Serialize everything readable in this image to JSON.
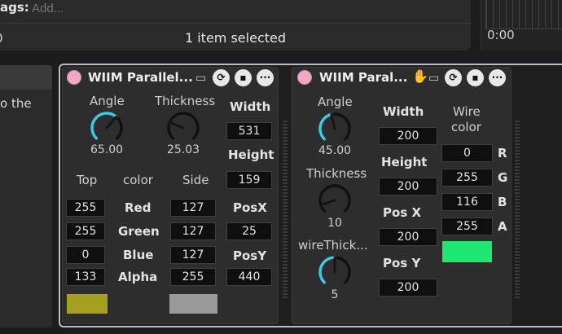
{
  "top": {
    "tags_label": "ags:",
    "tags_placeholder": "Add...",
    "selection_prefix": "0",
    "selection_text": "1 item selected",
    "time_readout": "0:00"
  },
  "left_panel": {
    "text": "o the"
  },
  "device1": {
    "title": "WIIM Parallel...",
    "angle_label": "Angle",
    "angle_value": "65.00",
    "angle_level": 0.65,
    "thickness_label": "Thickness",
    "thickness_value": "25.03",
    "thickness_level": 0.25,
    "top_label": "Top",
    "color_label": "color",
    "side_label": "Side",
    "top_color": [
      "255",
      "255",
      "0",
      "133"
    ],
    "side_color": [
      "127",
      "127",
      "127",
      "255"
    ],
    "channel_labels": [
      "Red",
      "Green",
      "Blue",
      "Alpha"
    ],
    "width_label": "Width",
    "width_value": "531",
    "height_label": "Height",
    "height_value": "159",
    "posx_label": "PosX",
    "posx_value": "25",
    "posy_label": "PosY",
    "posy_value": "440",
    "top_swatch": "#a5a022",
    "side_swatch": "#9a9a9a"
  },
  "device2": {
    "title": "WIIM Paral...",
    "angle_label": "Angle",
    "angle_value": "45.00",
    "angle_level": 0.45,
    "thickness_label": "Thickness",
    "thickness_value": "10",
    "thickness_level": 0.1,
    "wire_thick_label": "wireThick...",
    "wire_thick_value": "5",
    "wire_thick_level": 0.5,
    "width_label": "Width",
    "width_value": "200",
    "height_label": "Height",
    "height_value": "200",
    "posx_label": "Pos X",
    "posx_value": "200",
    "posy_label": "Pos Y",
    "posy_value": "200",
    "wire_color_label_1": "Wire",
    "wire_color_label_2": "color",
    "wire_color": [
      "0",
      "255",
      "116",
      "255"
    ],
    "channel_labels": [
      "R",
      "G",
      "B",
      "A"
    ],
    "wire_swatch": "#1ee871"
  },
  "colors": {
    "accent": "#3fc8e8",
    "power": "#f2a7c6"
  }
}
